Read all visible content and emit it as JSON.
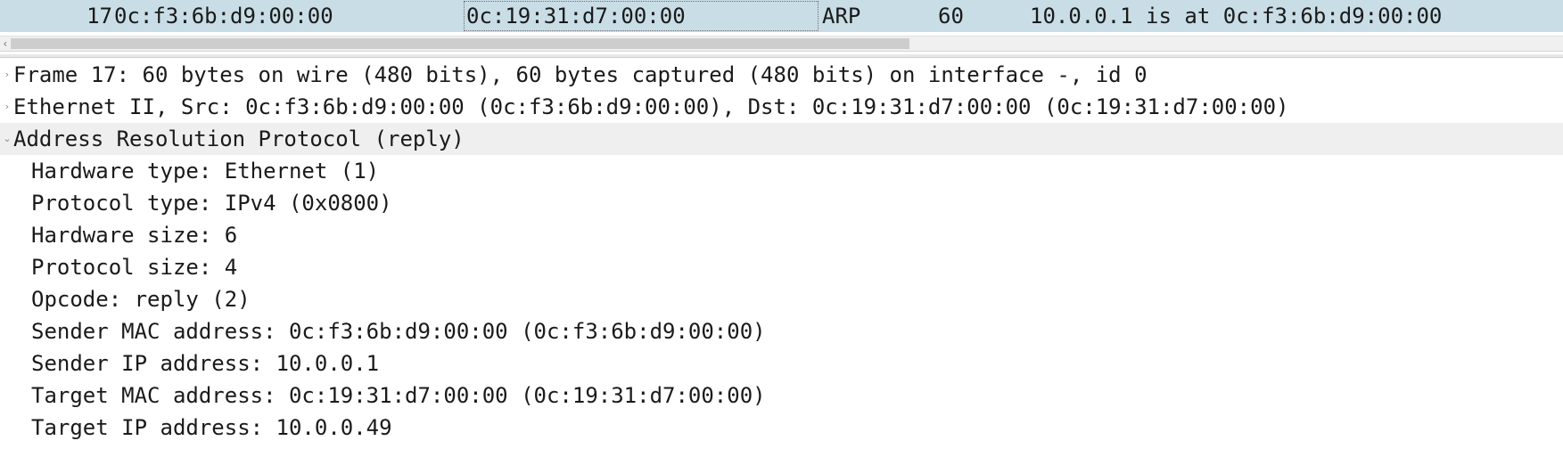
{
  "packet_list": {
    "selected_row": {
      "no": "17",
      "source": "0c:f3:6b:d9:00:00",
      "destination": "0c:19:31:d7:00:00",
      "protocol": "ARP",
      "length": "60",
      "info": "10.0.0.1 is at 0c:f3:6b:d9:00:00"
    },
    "scroll_left_icon": "chevron-left-icon"
  },
  "details": {
    "frame": {
      "toggle_icon": "chevron-right-icon",
      "label": "Frame 17: 60 bytes on wire (480 bits), 60 bytes captured (480 bits) on interface -, id 0"
    },
    "ethernet": {
      "toggle_icon": "chevron-right-icon",
      "label": "Ethernet II, Src: 0c:f3:6b:d9:00:00 (0c:f3:6b:d9:00:00), Dst: 0c:19:31:d7:00:00 (0c:19:31:d7:00:00)"
    },
    "arp": {
      "toggle_icon": "chevron-down-icon",
      "label": "Address Resolution Protocol (reply)",
      "fields": [
        "Hardware type: Ethernet (1)",
        "Protocol type: IPv4 (0x0800)",
        "Hardware size: 6",
        "Protocol size: 4",
        "Opcode: reply (2)",
        "Sender MAC address: 0c:f3:6b:d9:00:00 (0c:f3:6b:d9:00:00)",
        "Sender IP address: 10.0.0.1",
        "Target MAC address: 0c:19:31:d7:00:00 (0c:19:31:d7:00:00)",
        "Target IP address: 10.0.0.49"
      ]
    }
  },
  "colors": {
    "selected_packet_row": "#c9dde6",
    "selected_tree_row": "#efefef",
    "scrollbar_thumb": "#cdcdcd"
  }
}
